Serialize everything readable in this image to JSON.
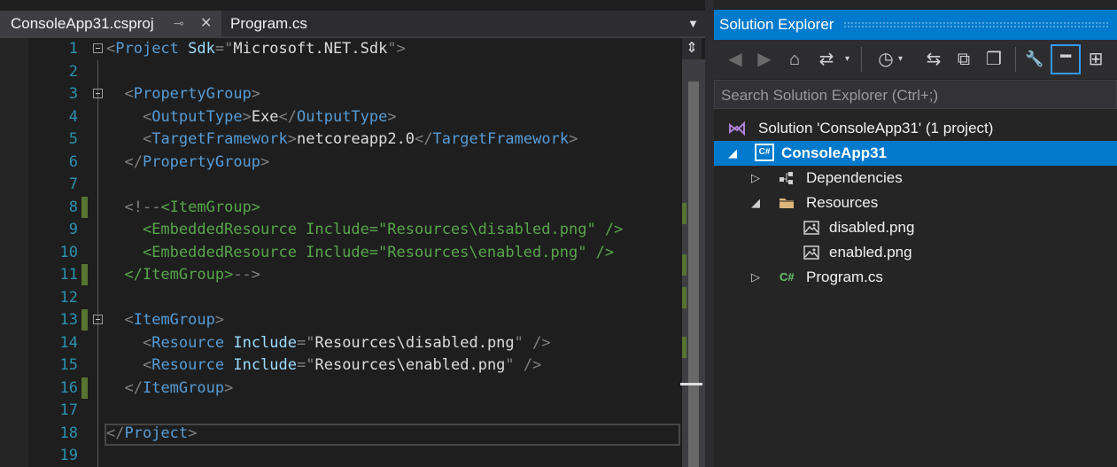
{
  "editor": {
    "tabs": [
      {
        "label": "ConsoleApp31.csproj",
        "active": true
      },
      {
        "label": "Program.cs",
        "active": false
      }
    ],
    "pin_glyph": "⊸",
    "close_glyph": "✕",
    "dropdown_glyph": "▼",
    "splitter_glyph": "⇕",
    "lines": [
      {
        "n": "1",
        "seg": [
          [
            "p",
            "<"
          ],
          [
            "t",
            "Project"
          ],
          [
            "x",
            " "
          ],
          [
            "a",
            "Sdk"
          ],
          [
            "p",
            "=\""
          ],
          [
            "x",
            "Microsoft.NET.Sdk"
          ],
          [
            "p",
            "\">"
          ]
        ]
      },
      {
        "n": "2",
        "seg": []
      },
      {
        "n": "3",
        "seg": [
          [
            "x",
            "  "
          ],
          [
            "p",
            "<"
          ],
          [
            "t",
            "PropertyGroup"
          ],
          [
            "p",
            ">"
          ]
        ]
      },
      {
        "n": "4",
        "seg": [
          [
            "x",
            "    "
          ],
          [
            "p",
            "<"
          ],
          [
            "t",
            "OutputType"
          ],
          [
            "p",
            ">"
          ],
          [
            "x",
            "Exe"
          ],
          [
            "p",
            "</"
          ],
          [
            "t",
            "OutputType"
          ],
          [
            "p",
            ">"
          ]
        ]
      },
      {
        "n": "5",
        "seg": [
          [
            "x",
            "    "
          ],
          [
            "p",
            "<"
          ],
          [
            "t",
            "TargetFramework"
          ],
          [
            "p",
            ">"
          ],
          [
            "x",
            "netcoreapp2.0"
          ],
          [
            "p",
            "</"
          ],
          [
            "t",
            "TargetFramework"
          ],
          [
            "p",
            ">"
          ]
        ]
      },
      {
        "n": "6",
        "seg": [
          [
            "x",
            "  "
          ],
          [
            "p",
            "</"
          ],
          [
            "t",
            "PropertyGroup"
          ],
          [
            "p",
            ">"
          ]
        ]
      },
      {
        "n": "7",
        "seg": []
      },
      {
        "n": "8",
        "seg": [
          [
            "x",
            "  "
          ],
          [
            "p",
            "<!--"
          ],
          [
            "c",
            "<ItemGroup>"
          ]
        ]
      },
      {
        "n": "9",
        "seg": [
          [
            "c",
            "    <EmbeddedResource Include=\"Resources\\disabled.png\" />"
          ]
        ]
      },
      {
        "n": "10",
        "seg": [
          [
            "c",
            "    <EmbeddedResource Include=\"Resources\\enabled.png\" />"
          ]
        ]
      },
      {
        "n": "11",
        "seg": [
          [
            "x",
            "  "
          ],
          [
            "c",
            "</ItemGroup>"
          ],
          [
            "p",
            "-->"
          ]
        ]
      },
      {
        "n": "12",
        "seg": []
      },
      {
        "n": "13",
        "seg": [
          [
            "x",
            "  "
          ],
          [
            "p",
            "<"
          ],
          [
            "t",
            "ItemGroup"
          ],
          [
            "p",
            ">"
          ]
        ]
      },
      {
        "n": "14",
        "seg": [
          [
            "x",
            "    "
          ],
          [
            "p",
            "<"
          ],
          [
            "t",
            "Resource"
          ],
          [
            "x",
            " "
          ],
          [
            "a",
            "Include"
          ],
          [
            "p",
            "=\""
          ],
          [
            "x",
            "Resources\\disabled.png"
          ],
          [
            "p",
            "\""
          ],
          [
            "x",
            " "
          ],
          [
            "p",
            "/>"
          ]
        ]
      },
      {
        "n": "15",
        "seg": [
          [
            "x",
            "    "
          ],
          [
            "p",
            "<"
          ],
          [
            "t",
            "Resource"
          ],
          [
            "x",
            " "
          ],
          [
            "a",
            "Include"
          ],
          [
            "p",
            "=\""
          ],
          [
            "x",
            "Resources\\enabled.png"
          ],
          [
            "p",
            "\""
          ],
          [
            "x",
            " "
          ],
          [
            "p",
            "/>"
          ]
        ]
      },
      {
        "n": "16",
        "seg": [
          [
            "x",
            "  "
          ],
          [
            "p",
            "</"
          ],
          [
            "t",
            "ItemGroup"
          ],
          [
            "p",
            ">"
          ]
        ]
      },
      {
        "n": "17",
        "seg": []
      },
      {
        "n": "18",
        "seg": [
          [
            "p",
            "</"
          ],
          [
            "t",
            "Project"
          ],
          [
            "p",
            ">"
          ]
        ]
      },
      {
        "n": "19",
        "seg": []
      }
    ]
  },
  "solution_explorer": {
    "title": "Solution Explorer",
    "toolbar_glyphs": {
      "back": "◀",
      "forward": "▶",
      "home": "⌂",
      "switch_views": "⇄",
      "pending_changes": "◷",
      "sync": "⇆",
      "collapse_all": "⧉",
      "show_all": "❐",
      "properties": "🔧",
      "preview": "━",
      "class_view": "⊞",
      "dropdown": "▾"
    },
    "search_placeholder": "Search Solution Explorer (Ctrl+;)",
    "tree": [
      {
        "label": "Solution 'ConsoleApp31' (1 project)",
        "icon": "solution-icon",
        "arrow": ""
      },
      {
        "label": "ConsoleApp31",
        "icon": "csharp-project-icon",
        "arrow": "◢",
        "selected": true
      },
      {
        "label": "Dependencies",
        "icon": "dependencies-icon",
        "arrow": "▷"
      },
      {
        "label": "Resources",
        "icon": "folder-icon",
        "arrow": "◢"
      },
      {
        "label": "disabled.png",
        "icon": "image-file-icon",
        "arrow": ""
      },
      {
        "label": "enabled.png",
        "icon": "image-file-icon",
        "arrow": ""
      },
      {
        "label": "Program.cs",
        "icon": "csharp-file-icon",
        "arrow": "▷"
      }
    ],
    "csharp_badge": "C#",
    "csharp_short": "C#"
  }
}
